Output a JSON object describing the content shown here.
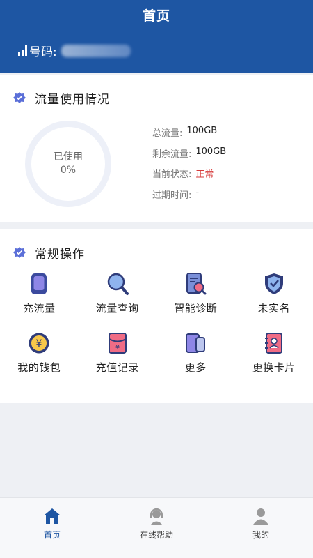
{
  "header": {
    "title": "首页",
    "phone_label": "号码:",
    "phone_icon": "signal-icon"
  },
  "usage": {
    "title": "流量使用情况",
    "ring_label": "已使用",
    "ring_percent": "0%",
    "used_fraction": 0,
    "stats": [
      {
        "label": "总流量:",
        "value": "100GB"
      },
      {
        "label": "剩余流量:",
        "value": "100GB"
      },
      {
        "label": "当前状态:",
        "value": "正常"
      },
      {
        "label": "过期时间:",
        "value": "-"
      }
    ]
  },
  "operations": {
    "title": "常规操作",
    "items": [
      {
        "label": "充流量",
        "icon": "tablet-icon"
      },
      {
        "label": "流量查询",
        "icon": "magnifier-icon"
      },
      {
        "label": "智能诊断",
        "icon": "diagnosis-icon"
      },
      {
        "label": "未实名",
        "icon": "shield-check-icon"
      },
      {
        "label": "我的钱包",
        "icon": "yuan-coin-icon"
      },
      {
        "label": "充值记录",
        "icon": "red-envelope-icon"
      },
      {
        "label": "更多",
        "icon": "cards-icon"
      },
      {
        "label": "更换卡片",
        "icon": "contact-book-icon"
      }
    ]
  },
  "tabbar": {
    "tabs": [
      {
        "label": "首页",
        "icon": "home-icon",
        "active": true
      },
      {
        "label": "在线帮助",
        "icon": "support-agent-icon",
        "active": false
      },
      {
        "label": "我的",
        "icon": "user-icon",
        "active": false
      }
    ]
  },
  "colors": {
    "brand": "#1e56a3",
    "status_ok": "#d63a3a"
  }
}
